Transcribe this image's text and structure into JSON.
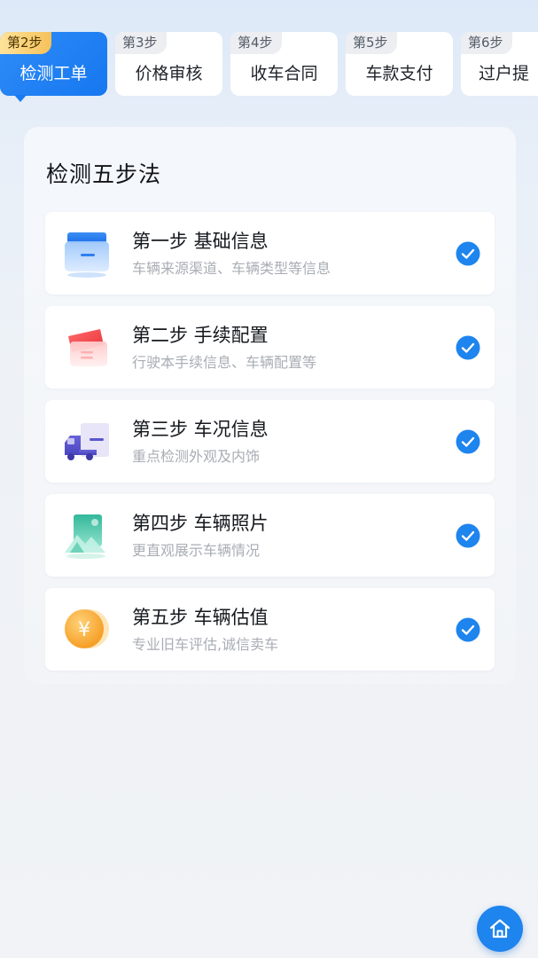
{
  "tabs": [
    {
      "step": "第2步",
      "label": "检测工单",
      "active": true
    },
    {
      "step": "第3步",
      "label": "价格审核",
      "active": false
    },
    {
      "step": "第4步",
      "label": "收车合同",
      "active": false
    },
    {
      "step": "第5步",
      "label": "车款支付",
      "active": false
    },
    {
      "step": "第6步",
      "label": "过户提",
      "active": false
    }
  ],
  "panel": {
    "title": "检测五步法",
    "steps": [
      {
        "title": "第一步 基础信息",
        "desc": "车辆来源渠道、车辆类型等信息",
        "icon": "inbox-tray-icon",
        "completed": true
      },
      {
        "title": "第二步 手续配置",
        "desc": "行驶本手续信息、车辆配置等",
        "icon": "documents-card-icon",
        "completed": true
      },
      {
        "title": "第三步 车况信息",
        "desc": "重点检测外观及内饰",
        "icon": "truck-icon",
        "completed": true
      },
      {
        "title": "第四步 车辆照片",
        "desc": "更直观展示车辆情况",
        "icon": "photo-icon",
        "completed": true
      },
      {
        "title": "第五步 车辆估值",
        "desc": "专业旧车评估,诚信卖车",
        "icon": "yuan-coin-icon",
        "completed": true
      }
    ]
  },
  "home_button": {
    "icon": "home-icon"
  },
  "colors": {
    "primary": "#1E84EE",
    "tab_badge_active": "#F6C15A",
    "text_primary": "#15181D",
    "text_secondary": "#A9ADB4"
  }
}
